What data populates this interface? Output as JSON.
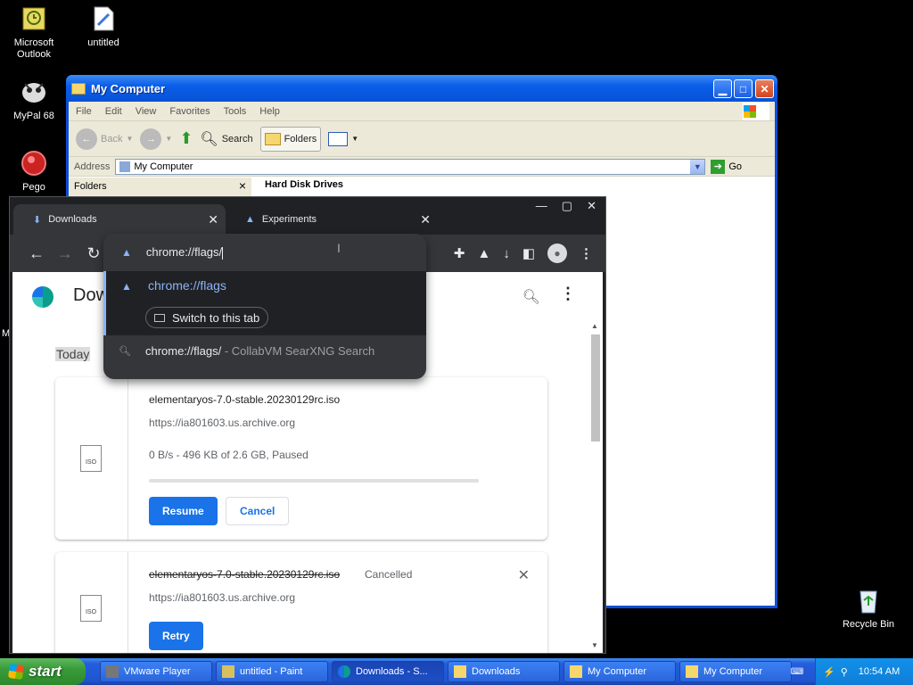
{
  "desktop": {
    "icons": [
      {
        "label": "Microsoft\nOutlook",
        "icon": "outlook-icon"
      },
      {
        "label": "untitled",
        "icon": "paint-file-icon"
      },
      {
        "label": "MyPal 68",
        "icon": "mypal-icon"
      },
      {
        "label": "Pego",
        "icon": "pego-icon"
      },
      {
        "label": "Recycle Bin",
        "icon": "recycle-bin-icon"
      }
    ],
    "stray_label": "M"
  },
  "explorer": {
    "title": "My Computer",
    "menu": [
      "File",
      "Edit",
      "View",
      "Favorites",
      "Tools",
      "Help"
    ],
    "toolbar": {
      "back": "Back",
      "search": "Search",
      "folders": "Folders"
    },
    "address_label": "Address",
    "address_value": "My Computer",
    "go": "Go",
    "folders_pane": "Folders",
    "section_header": "Hard Disk Drives"
  },
  "chrome": {
    "tabs": [
      {
        "label": "Downloads",
        "active": true
      },
      {
        "label": "Experiments",
        "active": false
      }
    ],
    "omnibox": {
      "input": "chrome://flags/",
      "suggestion_main": "chrome://flags",
      "switch_tab": "Switch to this tab",
      "suggestion_search": "chrome://flags/",
      "suggestion_search_sub": " - CollabVM SearXNG Search"
    },
    "downloads": {
      "title": "Downloads",
      "date_group": "Today",
      "items": [
        {
          "filename": "elementaryos-7.0-stable.20230129rc.iso",
          "url": "https://ia801603.us.archive.org",
          "status": "0 B/s - 496 KB of 2.6 GB, Paused",
          "progress": 0.0002,
          "primary_action": "Resume",
          "secondary_action": "Cancel"
        },
        {
          "filename": "elementaryos-7.0-stable.20230129rc.iso",
          "status_tag": "Cancelled",
          "url": "https://ia801603.us.archive.org",
          "primary_action": "Retry"
        }
      ]
    }
  },
  "taskbar": {
    "start": "start",
    "tasks": [
      {
        "label": "VMware Player",
        "icon": "vmware-icon"
      },
      {
        "label": "untitled - Paint",
        "icon": "paint-icon"
      },
      {
        "label": "Downloads - S...",
        "icon": "chrome-icon",
        "active": true
      },
      {
        "label": "Downloads",
        "icon": "folder-icon"
      },
      {
        "label": "My Computer",
        "icon": "folder-icon"
      },
      {
        "label": "My Computer",
        "icon": "folder-icon"
      }
    ],
    "clock": "10:54 AM"
  }
}
